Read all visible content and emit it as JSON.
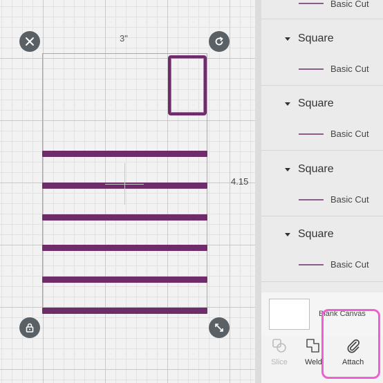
{
  "canvas": {
    "width_label": "3\"",
    "height_label": "4.15",
    "accent_color": "#6f2c6b"
  },
  "layers": {
    "top_partial_label": "Basic Cut",
    "groups": [
      {
        "name": "Square",
        "item": "Basic Cut"
      },
      {
        "name": "Square",
        "item": "Basic Cut"
      },
      {
        "name": "Square",
        "item": "Basic Cut"
      },
      {
        "name": "Square",
        "item": "Basic Cut"
      }
    ]
  },
  "blank_canvas": {
    "label": "Blank Canvas"
  },
  "toolbar": {
    "slice_label": "Slice",
    "weld_label": "Weld",
    "attach_label": "Attach"
  },
  "icons": [
    "close-icon",
    "rotate-icon",
    "lock-icon",
    "resize-icon",
    "slice-icon",
    "weld-icon",
    "paperclip-icon"
  ],
  "highlight_color": "#ee5fd1"
}
